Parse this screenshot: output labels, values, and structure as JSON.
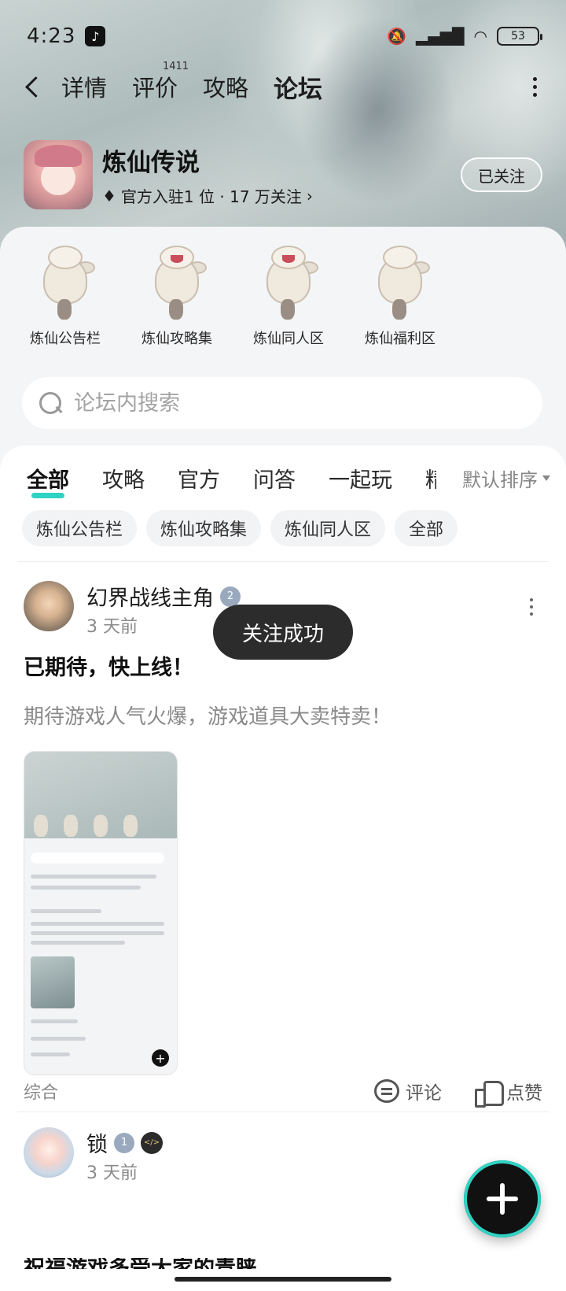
{
  "status_bar": {
    "time": "4:23",
    "battery": "53"
  },
  "nav": {
    "tabs": [
      {
        "label": "详情"
      },
      {
        "label": "评价",
        "badge": "1411"
      },
      {
        "label": "攻略"
      },
      {
        "label": "论坛",
        "active": true
      }
    ]
  },
  "game": {
    "name": "炼仙传说",
    "meta": "官方入驻1 位 · 17 万关注",
    "follow_label": "已关注"
  },
  "zones": [
    {
      "label": "炼仙公告栏"
    },
    {
      "label": "炼仙攻略集"
    },
    {
      "label": "炼仙同人区"
    },
    {
      "label": "炼仙福利区"
    }
  ],
  "search": {
    "placeholder": "论坛内搜索"
  },
  "filter_tabs": [
    {
      "label": "全部",
      "active": true
    },
    {
      "label": "攻略"
    },
    {
      "label": "官方"
    },
    {
      "label": "问答"
    },
    {
      "label": "一起玩"
    },
    {
      "label": "精华"
    }
  ],
  "sort": {
    "label": "默认排序"
  },
  "chips": [
    {
      "label": "炼仙公告栏"
    },
    {
      "label": "炼仙攻略集"
    },
    {
      "label": "炼仙同人区"
    },
    {
      "label": "全部"
    }
  ],
  "posts": [
    {
      "author": "幻界战线主角",
      "level": "2",
      "time": "3 天前",
      "title": "已期待，快上线！",
      "body": "期待游戏人气火爆，游戏道具大卖特卖！",
      "tag": "综合",
      "comment_label": "评论",
      "like_label": "点赞"
    },
    {
      "author": "锁",
      "level": "1",
      "time": "3 天前",
      "title_partial": "祝福游戏多受大家的青睐"
    }
  ],
  "toast": {
    "text": "关注成功"
  },
  "colors": {
    "accent": "#2fd3c3",
    "background": "#f4f5f7"
  }
}
